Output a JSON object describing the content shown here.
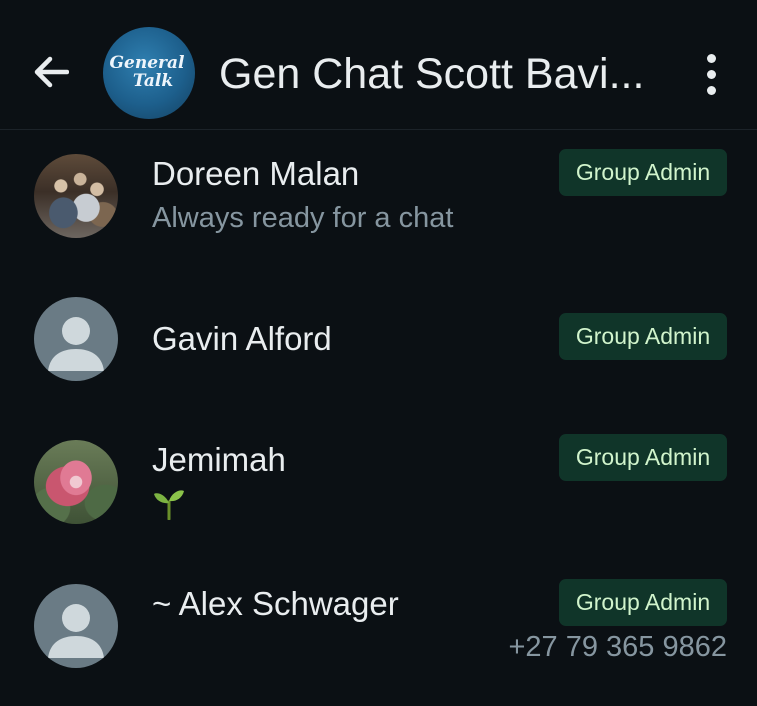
{
  "header": {
    "back_icon": "arrow-left-icon",
    "group_avatar_line1": "General",
    "group_avatar_line2": "Talk",
    "title": "Gen Chat Scott Bavi...",
    "menu_icon": "more-vertical-icon"
  },
  "members": [
    {
      "name": "Doreen Malan",
      "about": "Always ready for a chat",
      "badge": "Group Admin",
      "avatar": "photo"
    },
    {
      "name": "Gavin Alford",
      "about": "",
      "badge": "Group Admin",
      "avatar": "default-person-icon"
    },
    {
      "name": "Jemimah",
      "about_emoji": "seedling",
      "badge": "Group Admin",
      "avatar": "photo"
    },
    {
      "name": "~ Alex Schwager",
      "phone": "+27 79 365 9862",
      "badge": "Group Admin",
      "avatar": "default-person-icon"
    }
  ],
  "colors": {
    "background": "#0b1014",
    "badge_bg": "#103529",
    "badge_text": "#d1f4cc",
    "secondary_text": "#8696a0"
  }
}
